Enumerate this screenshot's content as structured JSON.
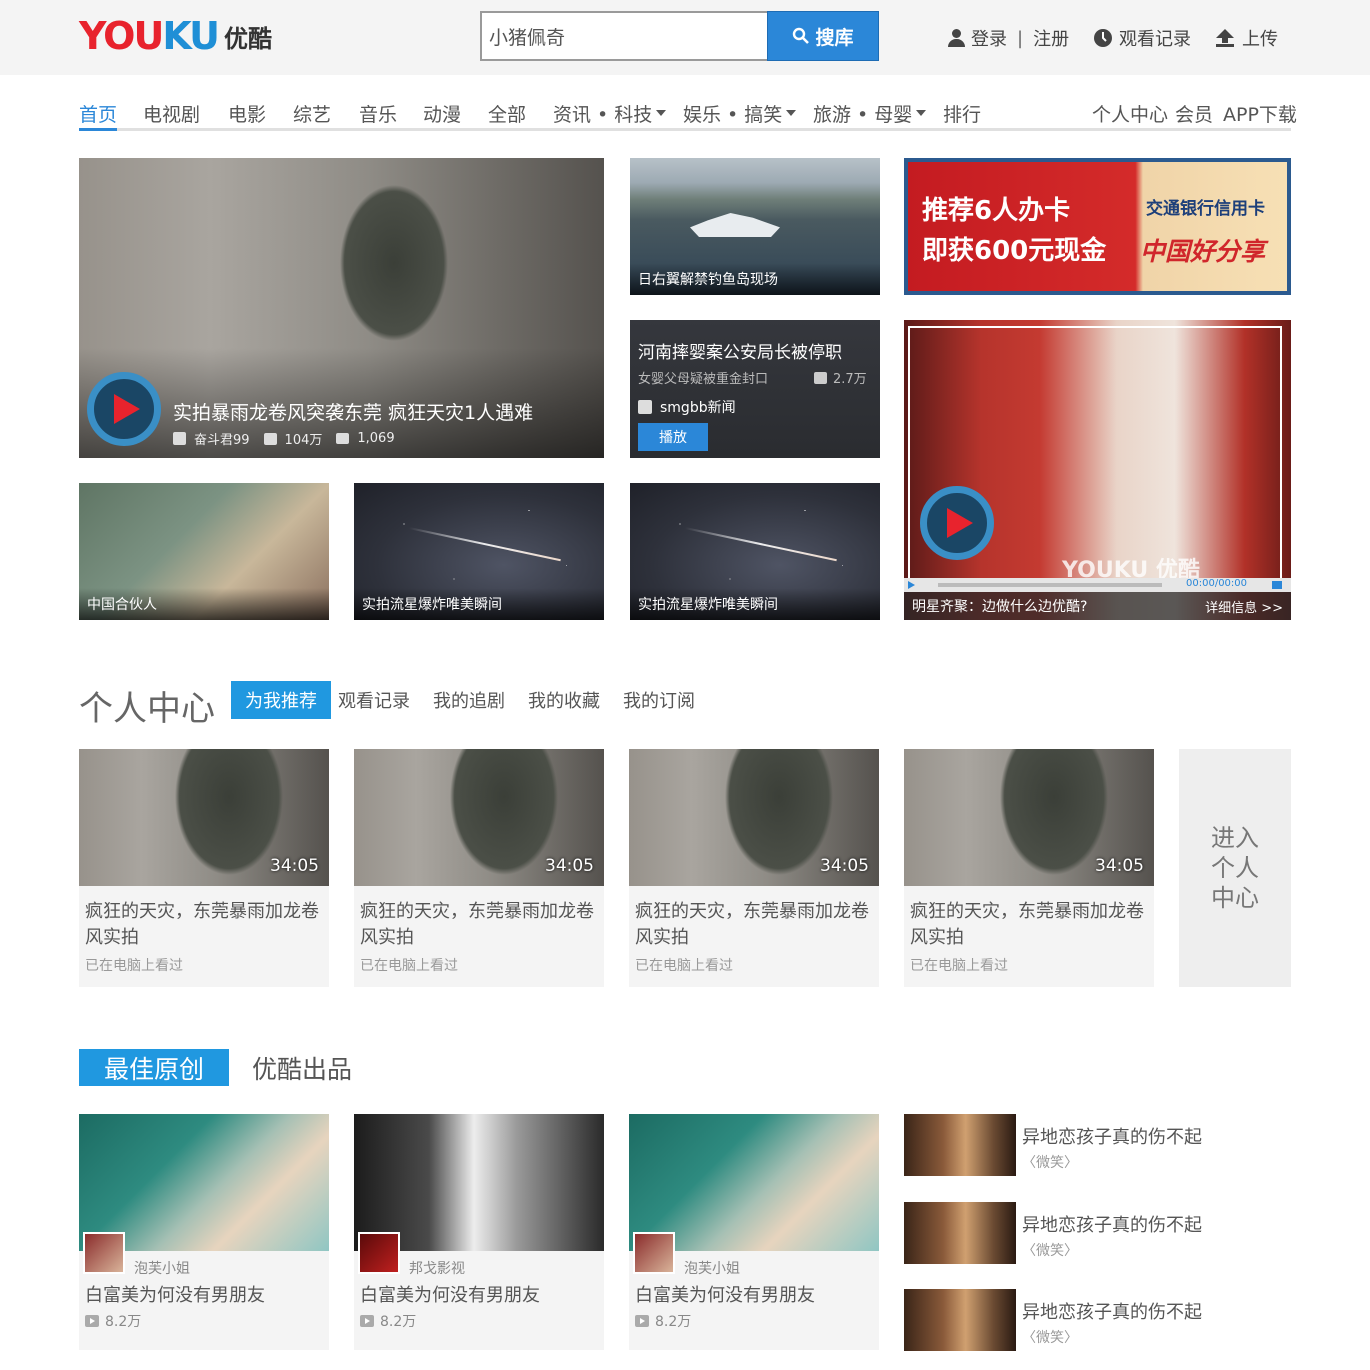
{
  "header": {
    "logo_main_a": "YOU",
    "logo_main_b": "KU",
    "logo_sub": "优酷",
    "search_value": "小猪佩奇",
    "search_button": "搜库",
    "login": "登录",
    "sep": "|",
    "register": "注册",
    "history": "观看记录",
    "upload": "上传"
  },
  "nav": {
    "items": [
      "首页",
      "电视剧",
      "电影",
      "综艺",
      "音乐",
      "动漫",
      "全部",
      "资讯 • 科技",
      "娱乐 • 搞笑",
      "旅游 • 母婴",
      "排行"
    ],
    "right": [
      "个人中心",
      "会员",
      "APP下载"
    ]
  },
  "featured": {
    "main": {
      "title": "实拍暴雨龙卷风突袭东莞 疯狂天灾1人遇难",
      "author": "奋斗君99",
      "views": "104万",
      "comments": "1,069"
    },
    "sea": {
      "caption": "日右翼解禁钓鱼岛现场"
    },
    "ad": {
      "line1": "推荐6人办卡",
      "line2": "即获600元现金",
      "bank": "交通银行信用卡",
      "slogan": "中国好分享"
    },
    "news": {
      "title": "河南摔婴案公安局长被停职",
      "subtitle": "女婴父母疑被重金封口",
      "views": "2.7万",
      "source": "smgbb新闻",
      "play": "播放"
    },
    "small": [
      {
        "caption": "中国合伙人"
      },
      {
        "caption": "实拍流星爆炸唯美瞬间"
      },
      {
        "caption": "实拍流星爆炸唯美瞬间"
      }
    ],
    "player": {
      "time": "00:00/00:00",
      "caption": "明星齐聚：边做什么边优酷?",
      "detail": "详细信息 >>",
      "watermark": "YOUKU 优酷"
    }
  },
  "personal": {
    "title": "个人中心",
    "tabs": [
      "为我推荐",
      "观看记录",
      "我的追剧",
      "我的收藏",
      "我的订阅"
    ],
    "cards": [
      {
        "duration": "34:05",
        "title": "疯狂的天灾，东莞暴雨加龙卷风实拍",
        "sub": "已在电脑上看过"
      },
      {
        "duration": "34:05",
        "title": "疯狂的天灾，东莞暴雨加龙卷风实拍",
        "sub": "已在电脑上看过"
      },
      {
        "duration": "34:05",
        "title": "疯狂的天灾，东莞暴雨加龙卷风实拍",
        "sub": "已在电脑上看过"
      },
      {
        "duration": "34:05",
        "title": "疯狂的天灾，东莞暴雨加龙卷风实拍",
        "sub": "已在电脑上看过"
      }
    ],
    "enter": "进入个人中心"
  },
  "originals": {
    "tab_active": "最佳原创",
    "tab": "优酷出品",
    "cards": [
      {
        "author": "泡芙小姐",
        "title": "白富美为何没有男朋友",
        "views": "8.2万"
      },
      {
        "author": "邦戈影视",
        "title": "白富美为何没有男朋友",
        "views": "8.2万"
      },
      {
        "author": "泡芙小姐",
        "title": "白富美为何没有男朋友",
        "views": "8.2万"
      }
    ],
    "side": [
      {
        "title": "异地恋孩子真的伤不起",
        "tag": "〈微笑〉"
      },
      {
        "title": "异地恋孩子真的伤不起",
        "tag": "〈微笑〉"
      },
      {
        "title": "异地恋孩子真的伤不起",
        "tag": "〈微笑〉"
      }
    ]
  },
  "colors": {
    "accent": "#2098e0",
    "brand_red": "#e8232d"
  }
}
